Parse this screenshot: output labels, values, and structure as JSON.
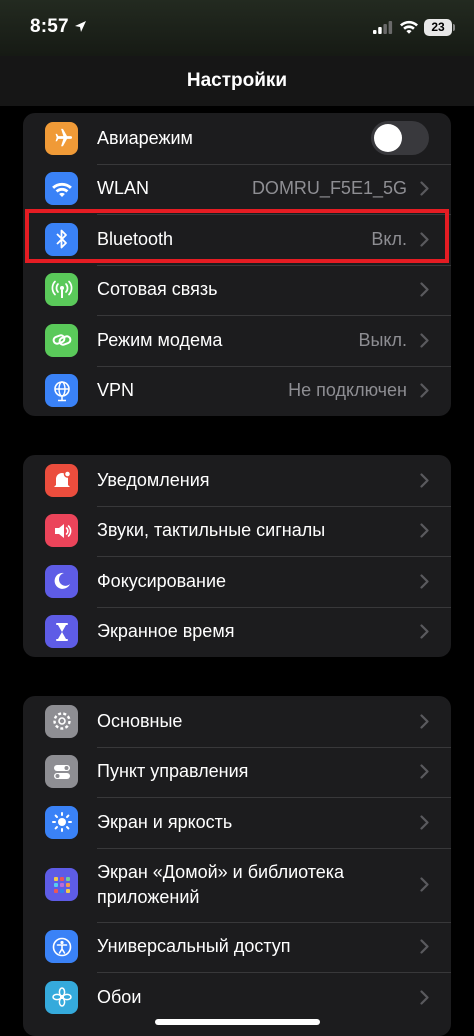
{
  "status": {
    "time": "8:57",
    "battery": "23"
  },
  "header": {
    "title": "Настройки"
  },
  "groups": [
    {
      "rows": [
        {
          "label": "Авиарежим",
          "icon": "airplane-icon",
          "color": "#f09a37",
          "toggle": false
        },
        {
          "label": "WLAN",
          "value": "DOMRU_F5E1_5G",
          "icon": "wifi-icon",
          "color": "#3a82f7"
        },
        {
          "label": "Bluetooth",
          "value": "Вкл.",
          "icon": "bluetooth-icon",
          "color": "#3a82f7"
        },
        {
          "label": "Сотовая связь",
          "icon": "antenna-icon",
          "color": "#5ac95a"
        },
        {
          "label": "Режим модема",
          "value": "Выкл.",
          "icon": "hotspot-chain-icon",
          "color": "#5ac95a"
        },
        {
          "label": "VPN",
          "value": "Не подключен",
          "icon": "globe-icon",
          "color": "#3a82f7"
        }
      ]
    },
    {
      "rows": [
        {
          "label": "Уведомления",
          "icon": "bell-icon",
          "color": "#eb4d3d"
        },
        {
          "label": "Звуки, тактильные сигналы",
          "icon": "speaker-icon",
          "color": "#eb445a"
        },
        {
          "label": "Фокусирование",
          "icon": "moon-icon",
          "color": "#5e5ce6"
        },
        {
          "label": "Экранное время",
          "icon": "hourglass-icon",
          "color": "#5e5ce6"
        }
      ]
    },
    {
      "rows": [
        {
          "label": "Основные",
          "icon": "gear-icon",
          "color": "#8e8e93"
        },
        {
          "label": "Пункт управления",
          "icon": "switches-icon",
          "color": "#8e8e93"
        },
        {
          "label": "Экран и яркость",
          "icon": "sun-icon",
          "color": "#3a82f7"
        },
        {
          "label": "Экран «Домой» и библиотека приложений",
          "label_line1": "Экран «Домой» и библиотека",
          "label_line2": "приложений",
          "icon": "home-grid-icon",
          "color": "#5e5ce6"
        },
        {
          "label": "Универсальный доступ",
          "icon": "accessibility-icon",
          "color": "#3a82f7"
        },
        {
          "label": "Обои",
          "icon": "flower-icon",
          "color": "#35aadc"
        }
      ]
    }
  ],
  "highlight": {
    "color": "#e51c23"
  }
}
